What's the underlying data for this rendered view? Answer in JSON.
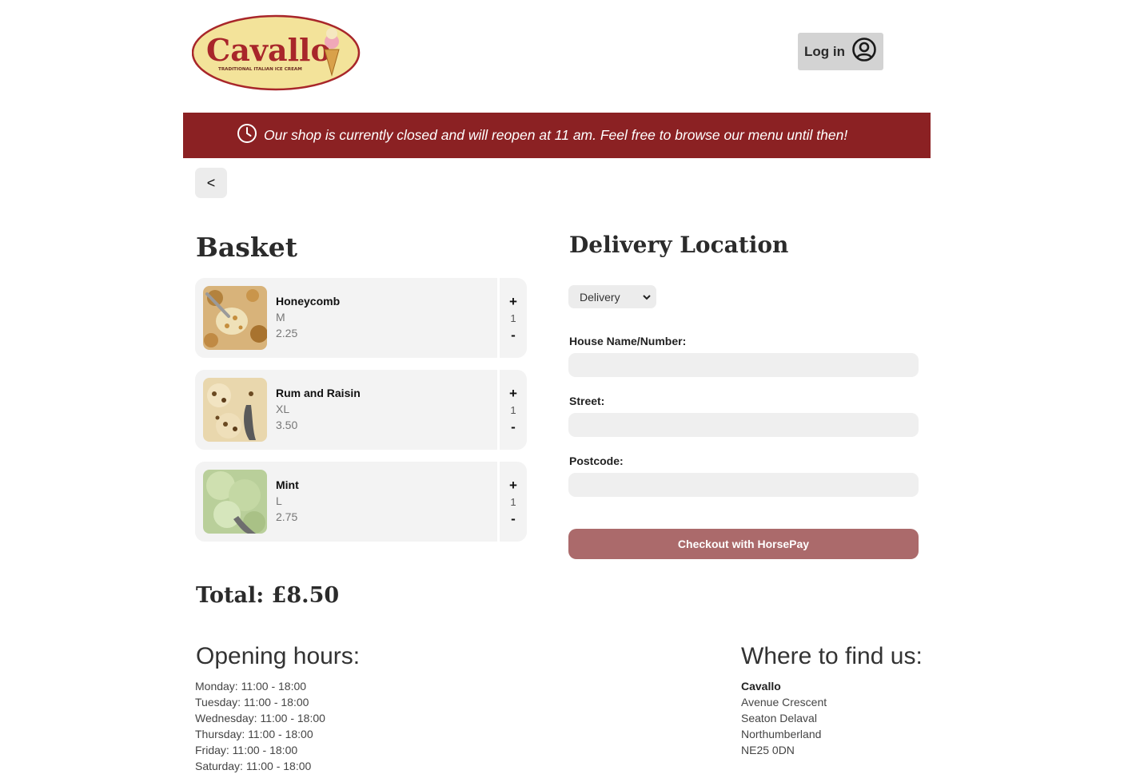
{
  "header": {
    "logo_text": "Cavallo",
    "logo_tagline": "TRADITIONAL ITALIAN ICE CREAM",
    "login_label": "Log in"
  },
  "banner": {
    "message": "Our shop is currently closed and will reopen at 11 am. Feel free to browse our menu until then!"
  },
  "nav": {
    "back_label": "<"
  },
  "basket": {
    "title": "Basket",
    "items": [
      {
        "name": "Honeycomb",
        "size": "M",
        "price": "2.25",
        "qty": "1",
        "plus": "+",
        "minus": "-"
      },
      {
        "name": "Rum and Raisin",
        "size": "XL",
        "price": "3.50",
        "qty": "1",
        "plus": "+",
        "minus": "-"
      },
      {
        "name": "Mint",
        "size": "L",
        "price": "2.75",
        "qty": "1",
        "plus": "+",
        "minus": "-"
      }
    ],
    "total": "Total: £8.50"
  },
  "delivery": {
    "title": "Delivery Location",
    "method_selected": "Delivery",
    "fields": [
      {
        "label": "House Name/Number:",
        "value": ""
      },
      {
        "label": "Street:",
        "value": ""
      },
      {
        "label": "Postcode:",
        "value": ""
      }
    ],
    "checkout_label": "Checkout with HorsePay"
  },
  "footer": {
    "hours_title": "Opening hours:",
    "hours": [
      "Monday: 11:00 - 18:00",
      "Tuesday: 11:00 - 18:00",
      "Wednesday: 11:00 - 18:00",
      "Thursday: 11:00 - 18:00",
      "Friday: 11:00 - 18:00",
      "Saturday: 11:00 - 18:00"
    ],
    "find_title": "Where to find us:",
    "address": {
      "name": "Cavallo",
      "lines": [
        "Avenue Crescent",
        "Seaton Delaval",
        "Northumberland",
        "NE25 0DN"
      ]
    }
  },
  "colors": {
    "brand_red": "#8b2123",
    "checkout_button": "#ab6a6b",
    "logo_fill": "#f3e39a"
  },
  "icons": {
    "login": "user-circle-icon",
    "banner": "clock-icon",
    "select": "chevron-down-icon"
  }
}
